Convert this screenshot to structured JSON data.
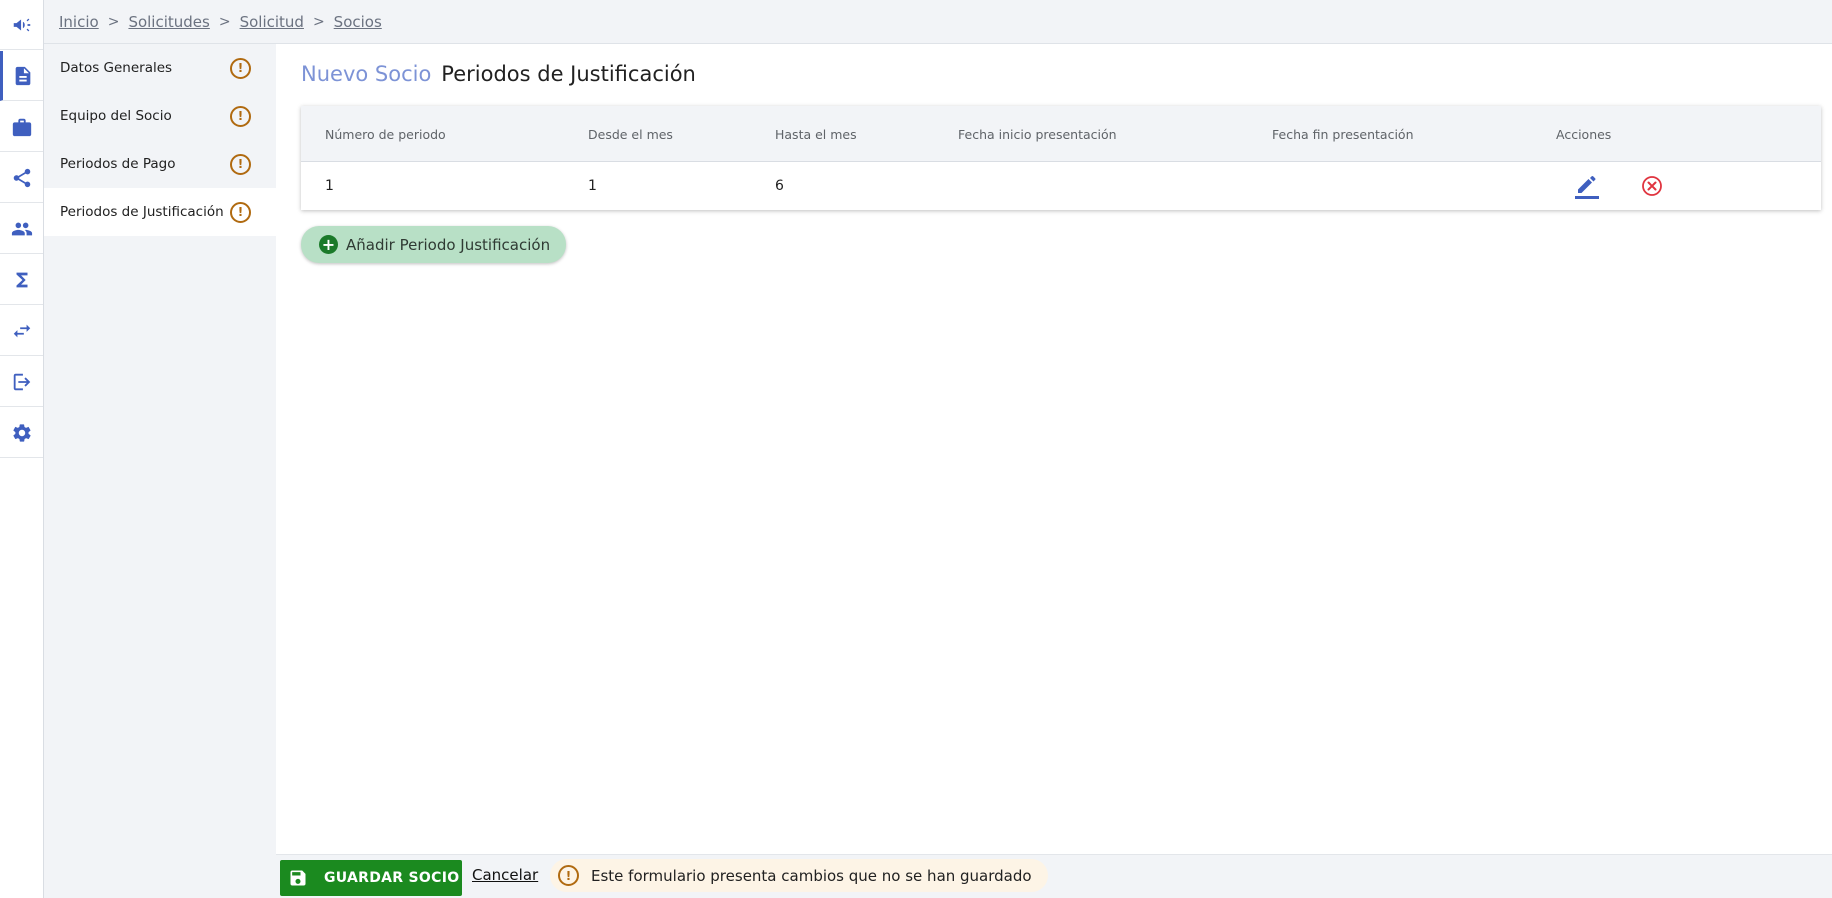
{
  "breadcrumb": {
    "items": [
      "Inicio",
      "Solicitudes",
      "Solicitud",
      "Socios"
    ],
    "separator": ">"
  },
  "rail": {
    "icons": [
      "megaphone-icon",
      "document-icon",
      "briefcase-icon",
      "share-icon",
      "people-icon",
      "sigma-icon",
      "swap-arrows-icon",
      "logout-icon",
      "gear-icon"
    ],
    "active": "document-icon",
    "color": "#3f5fbf"
  },
  "sections": {
    "items": [
      {
        "label": "Datos Generales",
        "warning": "!"
      },
      {
        "label": "Equipo del Socio",
        "warning": "!"
      },
      {
        "label": "Periodos de Pago",
        "warning": "!"
      },
      {
        "label": "Periodos de Justificación",
        "warning": "!"
      }
    ],
    "active_index": 3,
    "warning_color": "#b06a10"
  },
  "page": {
    "title_prefix": "Nuevo Socio",
    "title": "Periodos de Justificación"
  },
  "table": {
    "headers": [
      "Número de periodo",
      "Desde el mes",
      "Hasta el mes",
      "Fecha inicio presentación",
      "Fecha fin presentación",
      "Acciones"
    ],
    "rows": [
      {
        "numero": "1",
        "desde": "1",
        "hasta": "6",
        "fecha_inicio": "",
        "fecha_fin": "",
        "actions": [
          "edit-icon",
          "delete-icon"
        ]
      }
    ]
  },
  "add_button": {
    "label": "Añadir Periodo Justificación",
    "icon": "plus-circle-icon",
    "color": "#b8e0c6"
  },
  "footer": {
    "save_label": "GUARDAR SOCIO",
    "save_icon": "save-icon",
    "save_color": "#1b8a1f",
    "cancel_label": "Cancelar",
    "warning_icon_text": "!",
    "unsaved_message": "Este formulario presenta cambios que no se han guardado"
  }
}
